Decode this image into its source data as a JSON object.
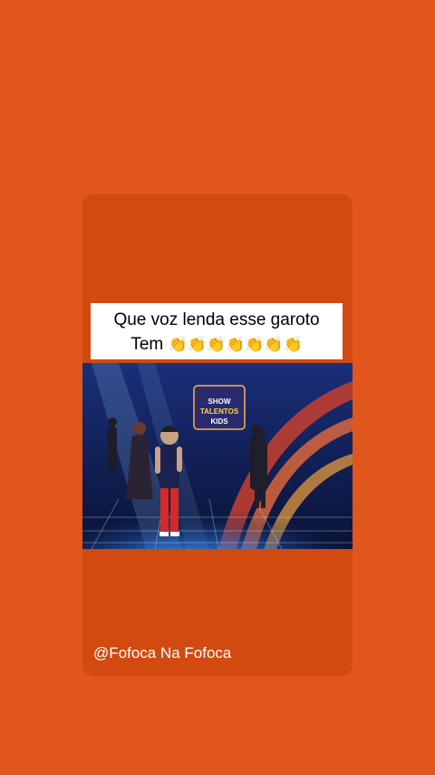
{
  "story": {
    "caption_line1": "Que voz lenda esse garoto",
    "caption_line2_text": "Tem",
    "caption_emojis": "👏👏👏👏👏👏👏",
    "handle": "@Fofoca Na Fofoca",
    "video_logo": "SHOW TALENTOS KIDS"
  },
  "colors": {
    "background": "#e0561d",
    "card": "#d24a0f",
    "caption_bg": "#ffffff"
  }
}
